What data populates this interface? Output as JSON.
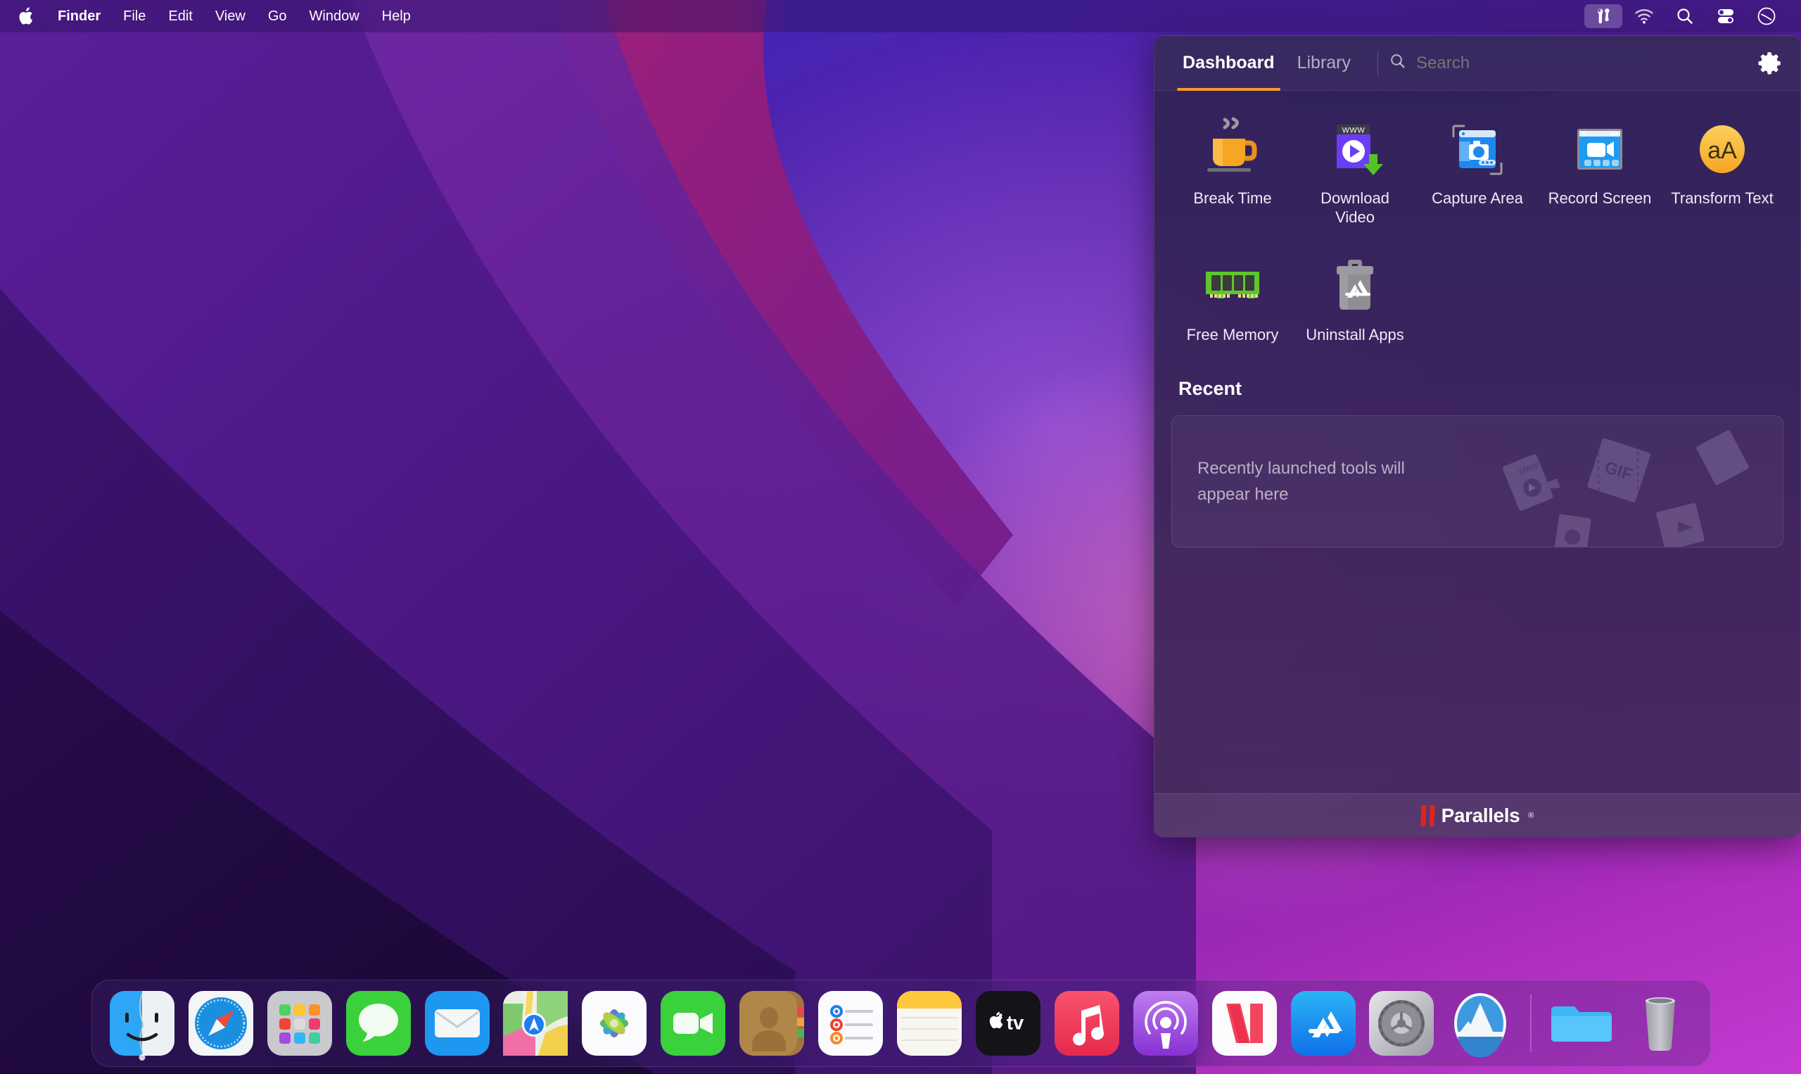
{
  "menubar": {
    "apple_icon": "apple-logo-icon",
    "items": [
      {
        "label": "Finder",
        "bold": true
      },
      {
        "label": "File",
        "bold": false
      },
      {
        "label": "Edit",
        "bold": false
      },
      {
        "label": "View",
        "bold": false
      },
      {
        "label": "Go",
        "bold": false
      },
      {
        "label": "Window",
        "bold": false
      },
      {
        "label": "Help",
        "bold": false
      }
    ],
    "status_items": [
      {
        "name": "parallels-toolbox-icon",
        "active": true
      },
      {
        "name": "wifi-warning-icon",
        "active": false
      },
      {
        "name": "spotlight-search-icon",
        "active": false
      },
      {
        "name": "control-center-icon",
        "active": false
      },
      {
        "name": "siri-icon",
        "active": false
      }
    ]
  },
  "panel": {
    "tabs": [
      {
        "label": "Dashboard",
        "active": true
      },
      {
        "label": "Library",
        "active": false
      }
    ],
    "search": {
      "placeholder": "Search",
      "value": "",
      "icon": "search-icon"
    },
    "settings_icon": "gear-icon",
    "tools": [
      {
        "label": "Break Time",
        "icon": "coffee-cup-icon",
        "color": "#f5a623"
      },
      {
        "label": "Download Video",
        "icon": "download-video-icon",
        "color": "#6b3df5"
      },
      {
        "label": "Capture Area",
        "icon": "capture-area-icon",
        "color": "#1e88f0"
      },
      {
        "label": "Record Screen",
        "icon": "record-screen-icon",
        "color": "#1e9bf0"
      },
      {
        "label": "Transform Text",
        "icon": "transform-text-icon",
        "color": "#f7b733"
      },
      {
        "label": "Free Memory",
        "icon": "memory-stick-icon",
        "color": "#5ec62b"
      },
      {
        "label": "Uninstall Apps",
        "icon": "uninstall-apps-icon",
        "color": "#8e8e93"
      }
    ],
    "recent": {
      "title": "Recent",
      "empty_text": "Recently launched tools will appear here"
    },
    "footer": {
      "brand": "Parallels",
      "registered_mark": "®",
      "accent_color": "#e0241c"
    },
    "accent_color": "#f59b2a"
  },
  "dock": {
    "items": [
      {
        "name": "finder",
        "running": true
      },
      {
        "name": "safari",
        "running": false
      },
      {
        "name": "launchpad",
        "running": false
      },
      {
        "name": "messages",
        "running": false
      },
      {
        "name": "mail",
        "running": false
      },
      {
        "name": "maps",
        "running": false
      },
      {
        "name": "photos",
        "running": false
      },
      {
        "name": "facetime",
        "running": false
      },
      {
        "name": "contacts",
        "running": false
      },
      {
        "name": "reminders",
        "running": false
      },
      {
        "name": "notes",
        "running": false
      },
      {
        "name": "apple-tv",
        "running": false
      },
      {
        "name": "music",
        "running": false
      },
      {
        "name": "podcasts",
        "running": false
      },
      {
        "name": "news",
        "running": false
      },
      {
        "name": "app-store",
        "running": false
      },
      {
        "name": "system-preferences",
        "running": false
      },
      {
        "name": "parallels-desktop",
        "running": false
      }
    ],
    "trailing": [
      {
        "name": "downloads-folder"
      },
      {
        "name": "trash"
      }
    ]
  }
}
